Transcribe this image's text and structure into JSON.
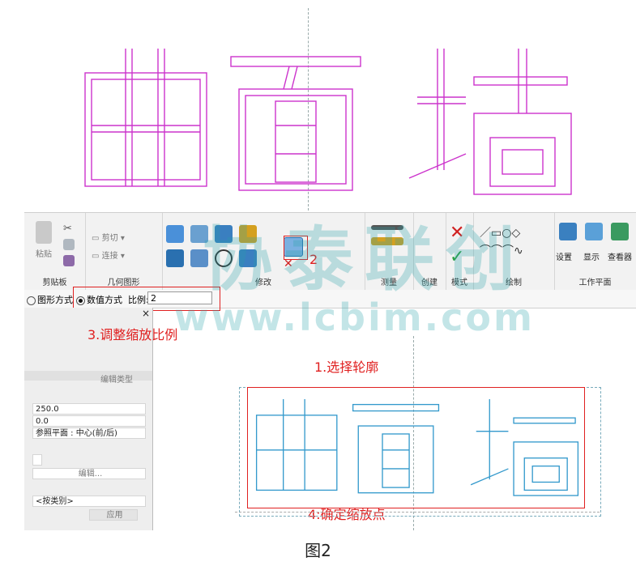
{
  "ribbon": {
    "panels": {
      "clipboard": "剪贴板",
      "geometry": "几何图形",
      "modify": "修改",
      "measure": "测量",
      "create": "创建",
      "mode": "模式",
      "draw": "绘制",
      "workplane": "工作平面"
    },
    "paste": "粘贴",
    "cut": "剪切",
    "join": "连接",
    "set": "设置",
    "show": "显示",
    "viewer": "查看器",
    "step2": "2"
  },
  "options_bar": {
    "graphical": "图形方式",
    "numerical": "数值方式",
    "scale_label": "比例:",
    "scale_value": "2"
  },
  "properties": {
    "edit_type": "编辑类型",
    "values": [
      "250.0",
      "0.0",
      "参照平面 : 中心(前/后)"
    ],
    "edit_button": "编辑...",
    "by_category": "<按类别>",
    "apply": "应用",
    "close": "×"
  },
  "annotations": {
    "step1": "1.选择轮廓",
    "step3": "3.调整缩放比例",
    "step4": "4:确定缩放点"
  },
  "glyphs": {
    "text": "曲面墙",
    "top_color": "#cc33cc",
    "bottom_color": "#3399cc"
  },
  "watermark": {
    "brand": "协泰联创",
    "url": "www.lcbim.com"
  },
  "caption": "图2"
}
